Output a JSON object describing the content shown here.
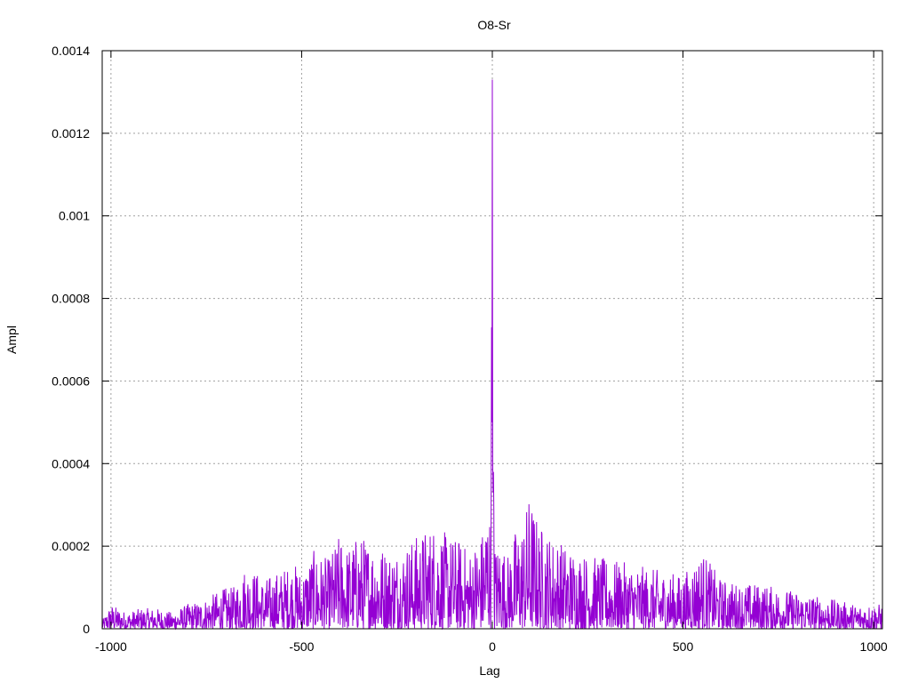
{
  "chart_data": {
    "type": "line",
    "title": "O8-Sr",
    "xlabel": "Lag",
    "ylabel": "Ampl",
    "xlim": [
      -1023,
      1023
    ],
    "ylim": [
      0,
      0.0014
    ],
    "x_ticks": [
      -1000,
      -500,
      0,
      500,
      1000
    ],
    "x_tick_labels": [
      "-1000",
      "-500",
      "0",
      "500",
      "1000"
    ],
    "y_ticks": [
      0,
      0.0002,
      0.0004,
      0.0006,
      0.0008,
      0.001,
      0.0012,
      0.0014
    ],
    "y_tick_labels": [
      "0",
      "0.0002",
      "0.0004",
      "0.0006",
      "0.0008",
      "0.001",
      "0.0012",
      "0.0014"
    ],
    "grid": true,
    "line_color": "#9400d3",
    "series": [
      {
        "x": [
          -1023,
          -1000,
          -960,
          -920,
          -880,
          -840,
          -800,
          -760,
          -720,
          -700,
          -680,
          -650,
          -620,
          -600,
          -560,
          -520,
          -500,
          -470,
          -450,
          -430,
          -400,
          -380,
          -350,
          -330,
          -300,
          -270,
          -240,
          -210,
          -180,
          -150,
          -120,
          -90,
          -60,
          -40,
          -30,
          -20,
          -10,
          -5,
          -3,
          -2,
          -1,
          0,
          1,
          2,
          3,
          5,
          10,
          20,
          40,
          60,
          80,
          95,
          100,
          120,
          150,
          170,
          200,
          250,
          300,
          350,
          400,
          450,
          500,
          550,
          600,
          650,
          700,
          750,
          800,
          850,
          900,
          950,
          1000,
          1023
        ],
        "y": [
          2e-05,
          6e-05,
          4e-05,
          5e-05,
          5e-05,
          4e-05,
          6e-05,
          7e-05,
          9e-05,
          0.0001,
          0.0001,
          0.00015,
          0.00014,
          0.00012,
          0.00014,
          0.00016,
          0.00014,
          0.00019,
          0.00018,
          0.00017,
          0.00023,
          0.0002,
          0.00023,
          0.00022,
          0.00021,
          0.00019,
          0.0002,
          0.00022,
          0.00024,
          0.00026,
          0.00023,
          0.00022,
          0.00019,
          0.00022,
          0.00023,
          0.00026,
          0.00035,
          0.00025,
          0.00033,
          0.00073,
          0.0005,
          0.00133,
          0.0004,
          0.00033,
          0.00038,
          0.00026,
          0.0002,
          0.00022,
          0.00018,
          0.00024,
          0.00026,
          0.00032,
          0.00033,
          0.00026,
          0.00023,
          0.00022,
          0.0002,
          0.00018,
          0.00017,
          0.00016,
          0.00015,
          0.00014,
          0.00013,
          0.00019,
          0.00012,
          0.00011,
          0.00011,
          0.0001,
          9e-05,
          8e-05,
          7e-05,
          6e-05,
          6e-05,
          6e-05
        ]
      }
    ]
  }
}
